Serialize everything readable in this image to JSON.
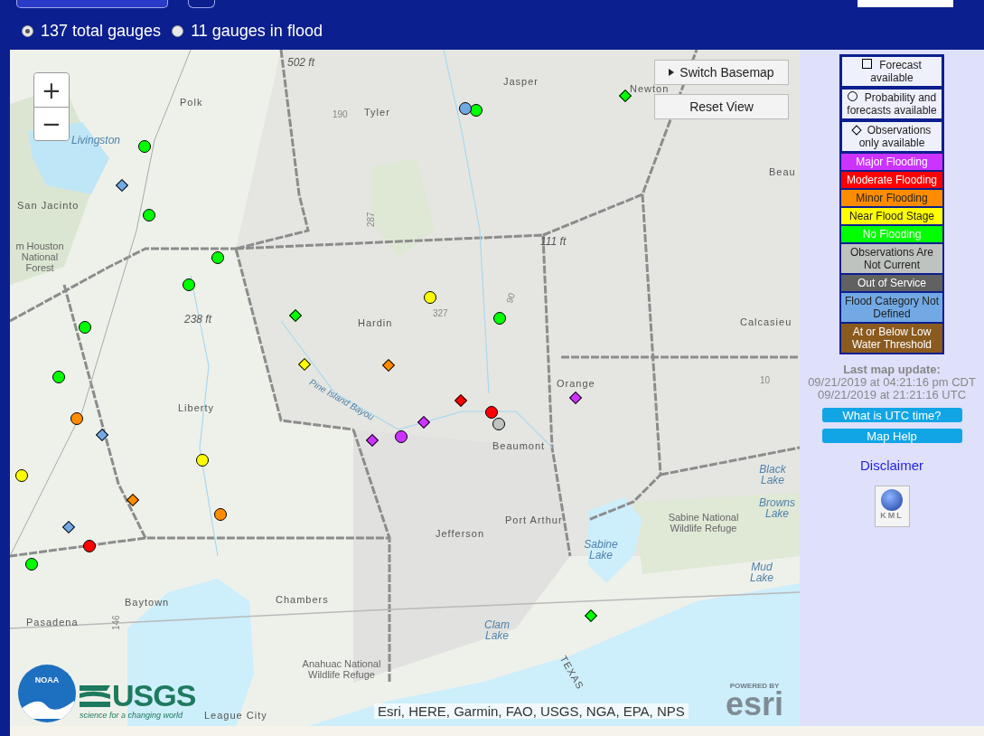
{
  "filters": [
    {
      "label": "137 total gauges",
      "selected": true
    },
    {
      "label": "11 gauges in flood",
      "selected": false
    }
  ],
  "map": {
    "zoom_in": "+",
    "zoom_out": "−",
    "switch_basemap": "Switch Basemap",
    "reset_view": "Reset View",
    "labels": [
      {
        "kind": "elevation",
        "text": "502 ft"
      },
      {
        "kind": "place",
        "text": "Polk"
      },
      {
        "kind": "road",
        "text": "190"
      },
      {
        "kind": "place",
        "text": "Tyler"
      },
      {
        "kind": "place",
        "text": "Jasper"
      },
      {
        "kind": "place",
        "text": "Newton"
      },
      {
        "kind": "water",
        "text": "Livingston"
      },
      {
        "kind": "place",
        "text": "San Jacinto"
      },
      {
        "kind": "park",
        "text": "m Houston National Forest"
      },
      {
        "kind": "road",
        "text": "287"
      },
      {
        "kind": "elevation",
        "text": "111 ft"
      },
      {
        "kind": "elevation",
        "text": "238 ft"
      },
      {
        "kind": "place",
        "text": "Hardin"
      },
      {
        "kind": "road",
        "text": "327"
      },
      {
        "kind": "road",
        "text": "90"
      },
      {
        "kind": "place",
        "text": "Beau"
      },
      {
        "kind": "place",
        "text": "Calcasieu"
      },
      {
        "kind": "water",
        "text": "Pine Island Bayou"
      },
      {
        "kind": "place",
        "text": "Liberty"
      },
      {
        "kind": "place",
        "text": "Orange"
      },
      {
        "kind": "road",
        "text": "10"
      },
      {
        "kind": "place",
        "text": "Beaumont"
      },
      {
        "kind": "water",
        "text": "Black Lake"
      },
      {
        "kind": "water",
        "text": "Browns Lake"
      },
      {
        "kind": "place",
        "text": "Port Arthur"
      },
      {
        "kind": "park",
        "text": "Sabine National Wildlife Refuge"
      },
      {
        "kind": "place",
        "text": "Jefferson"
      },
      {
        "kind": "water",
        "text": "Sabine Lake"
      },
      {
        "kind": "water",
        "text": "Mud Lake"
      },
      {
        "kind": "place",
        "text": "Chambers"
      },
      {
        "kind": "place",
        "text": "Baytown"
      },
      {
        "kind": "place",
        "text": "Pasadena"
      },
      {
        "kind": "road",
        "text": "146"
      },
      {
        "kind": "water",
        "text": "Clam Lake"
      },
      {
        "kind": "place",
        "text": "TEXAS"
      },
      {
        "kind": "park",
        "text": "Anahuac National Wildlife Refuge"
      },
      {
        "kind": "place",
        "text": "League City"
      }
    ],
    "gauges": [
      {
        "kind": "circle",
        "color": "#00ff00"
      },
      {
        "kind": "circle",
        "color": "#00ff00"
      },
      {
        "kind": "circle",
        "color": "#00ff00"
      },
      {
        "kind": "circle",
        "color": "#00ff00"
      },
      {
        "kind": "circle",
        "color": "#00ff00"
      },
      {
        "kind": "circle",
        "color": "#00ff00"
      },
      {
        "kind": "circle",
        "color": "#00ff00"
      },
      {
        "kind": "circle",
        "color": "#00ff00"
      },
      {
        "kind": "circle",
        "color": "#00ff00"
      },
      {
        "kind": "circle",
        "color": "#72a9e4"
      },
      {
        "kind": "circle",
        "color": "#ffff00"
      },
      {
        "kind": "circle",
        "color": "#ffff00"
      },
      {
        "kind": "circle",
        "color": "#ffff00"
      },
      {
        "kind": "circle",
        "color": "#ff8c00"
      },
      {
        "kind": "circle",
        "color": "#ff8c00"
      },
      {
        "kind": "circle",
        "color": "#ff0000"
      },
      {
        "kind": "circle",
        "color": "#ff0000"
      },
      {
        "kind": "circle",
        "color": "#bfc3bf"
      },
      {
        "kind": "circle",
        "color": "#cc33ff"
      },
      {
        "kind": "diamond",
        "color": "#72a9e4"
      },
      {
        "kind": "diamond",
        "color": "#72a9e4"
      },
      {
        "kind": "diamond",
        "color": "#72a9e4"
      },
      {
        "kind": "diamond",
        "color": "#00ff00"
      },
      {
        "kind": "diamond",
        "color": "#00ff00"
      },
      {
        "kind": "diamond",
        "color": "#00ff00"
      },
      {
        "kind": "diamond",
        "color": "#ffff00"
      },
      {
        "kind": "diamond",
        "color": "#ff8c00"
      },
      {
        "kind": "diamond",
        "color": "#ff8c00"
      },
      {
        "kind": "diamond",
        "color": "#ff0000"
      },
      {
        "kind": "diamond",
        "color": "#cc33ff"
      },
      {
        "kind": "diamond",
        "color": "#cc33ff"
      },
      {
        "kind": "diamond",
        "color": "#cc33ff"
      }
    ],
    "attribution": "Esri, HERE, Garmin, FAO, USGS, NGA, EPA, NPS",
    "noaa_logo": "NOAA",
    "usgs_logo": "USGS",
    "usgs_tagline": "science for a changing world",
    "esri_powered": "POWERED BY",
    "esri_logo": "esri"
  },
  "legend": [
    {
      "kind": "square",
      "label": "Forecast available"
    },
    {
      "kind": "circle",
      "label": "Probability and forecasts available"
    },
    {
      "kind": "diamond",
      "label": "Observations only available"
    },
    {
      "kind": "category",
      "color": "#cc33ff",
      "label": "Major Flooding"
    },
    {
      "kind": "category",
      "color": "#ff0000",
      "label": "Moderate Flooding"
    },
    {
      "kind": "category",
      "color": "#ff8c00",
      "label": "Minor Flooding"
    },
    {
      "kind": "category",
      "color": "#ffff00",
      "label": "Near Flood Stage"
    },
    {
      "kind": "category",
      "color": "#00ff00",
      "label": "No Flooding"
    },
    {
      "kind": "category",
      "color": "#bfc3bf",
      "label": "Observations Are Not Current"
    },
    {
      "kind": "category",
      "color": "#616161",
      "label": "Out of Service"
    },
    {
      "kind": "category",
      "color": "#72a9e4",
      "label": "Flood Category Not Defined"
    },
    {
      "kind": "category",
      "color": "#8b5a1e",
      "label": "At or Below Low Water Threshold"
    }
  ],
  "update": {
    "heading": "Last map update:",
    "cdt": "09/21/2019 at 04:21:16 pm CDT",
    "utc": "09/21/2019 at 21:21:16 UTC"
  },
  "buttons": [
    "What is UTC time?",
    "Map Help"
  ],
  "disclaimer": "Disclaimer",
  "kml": "KML"
}
